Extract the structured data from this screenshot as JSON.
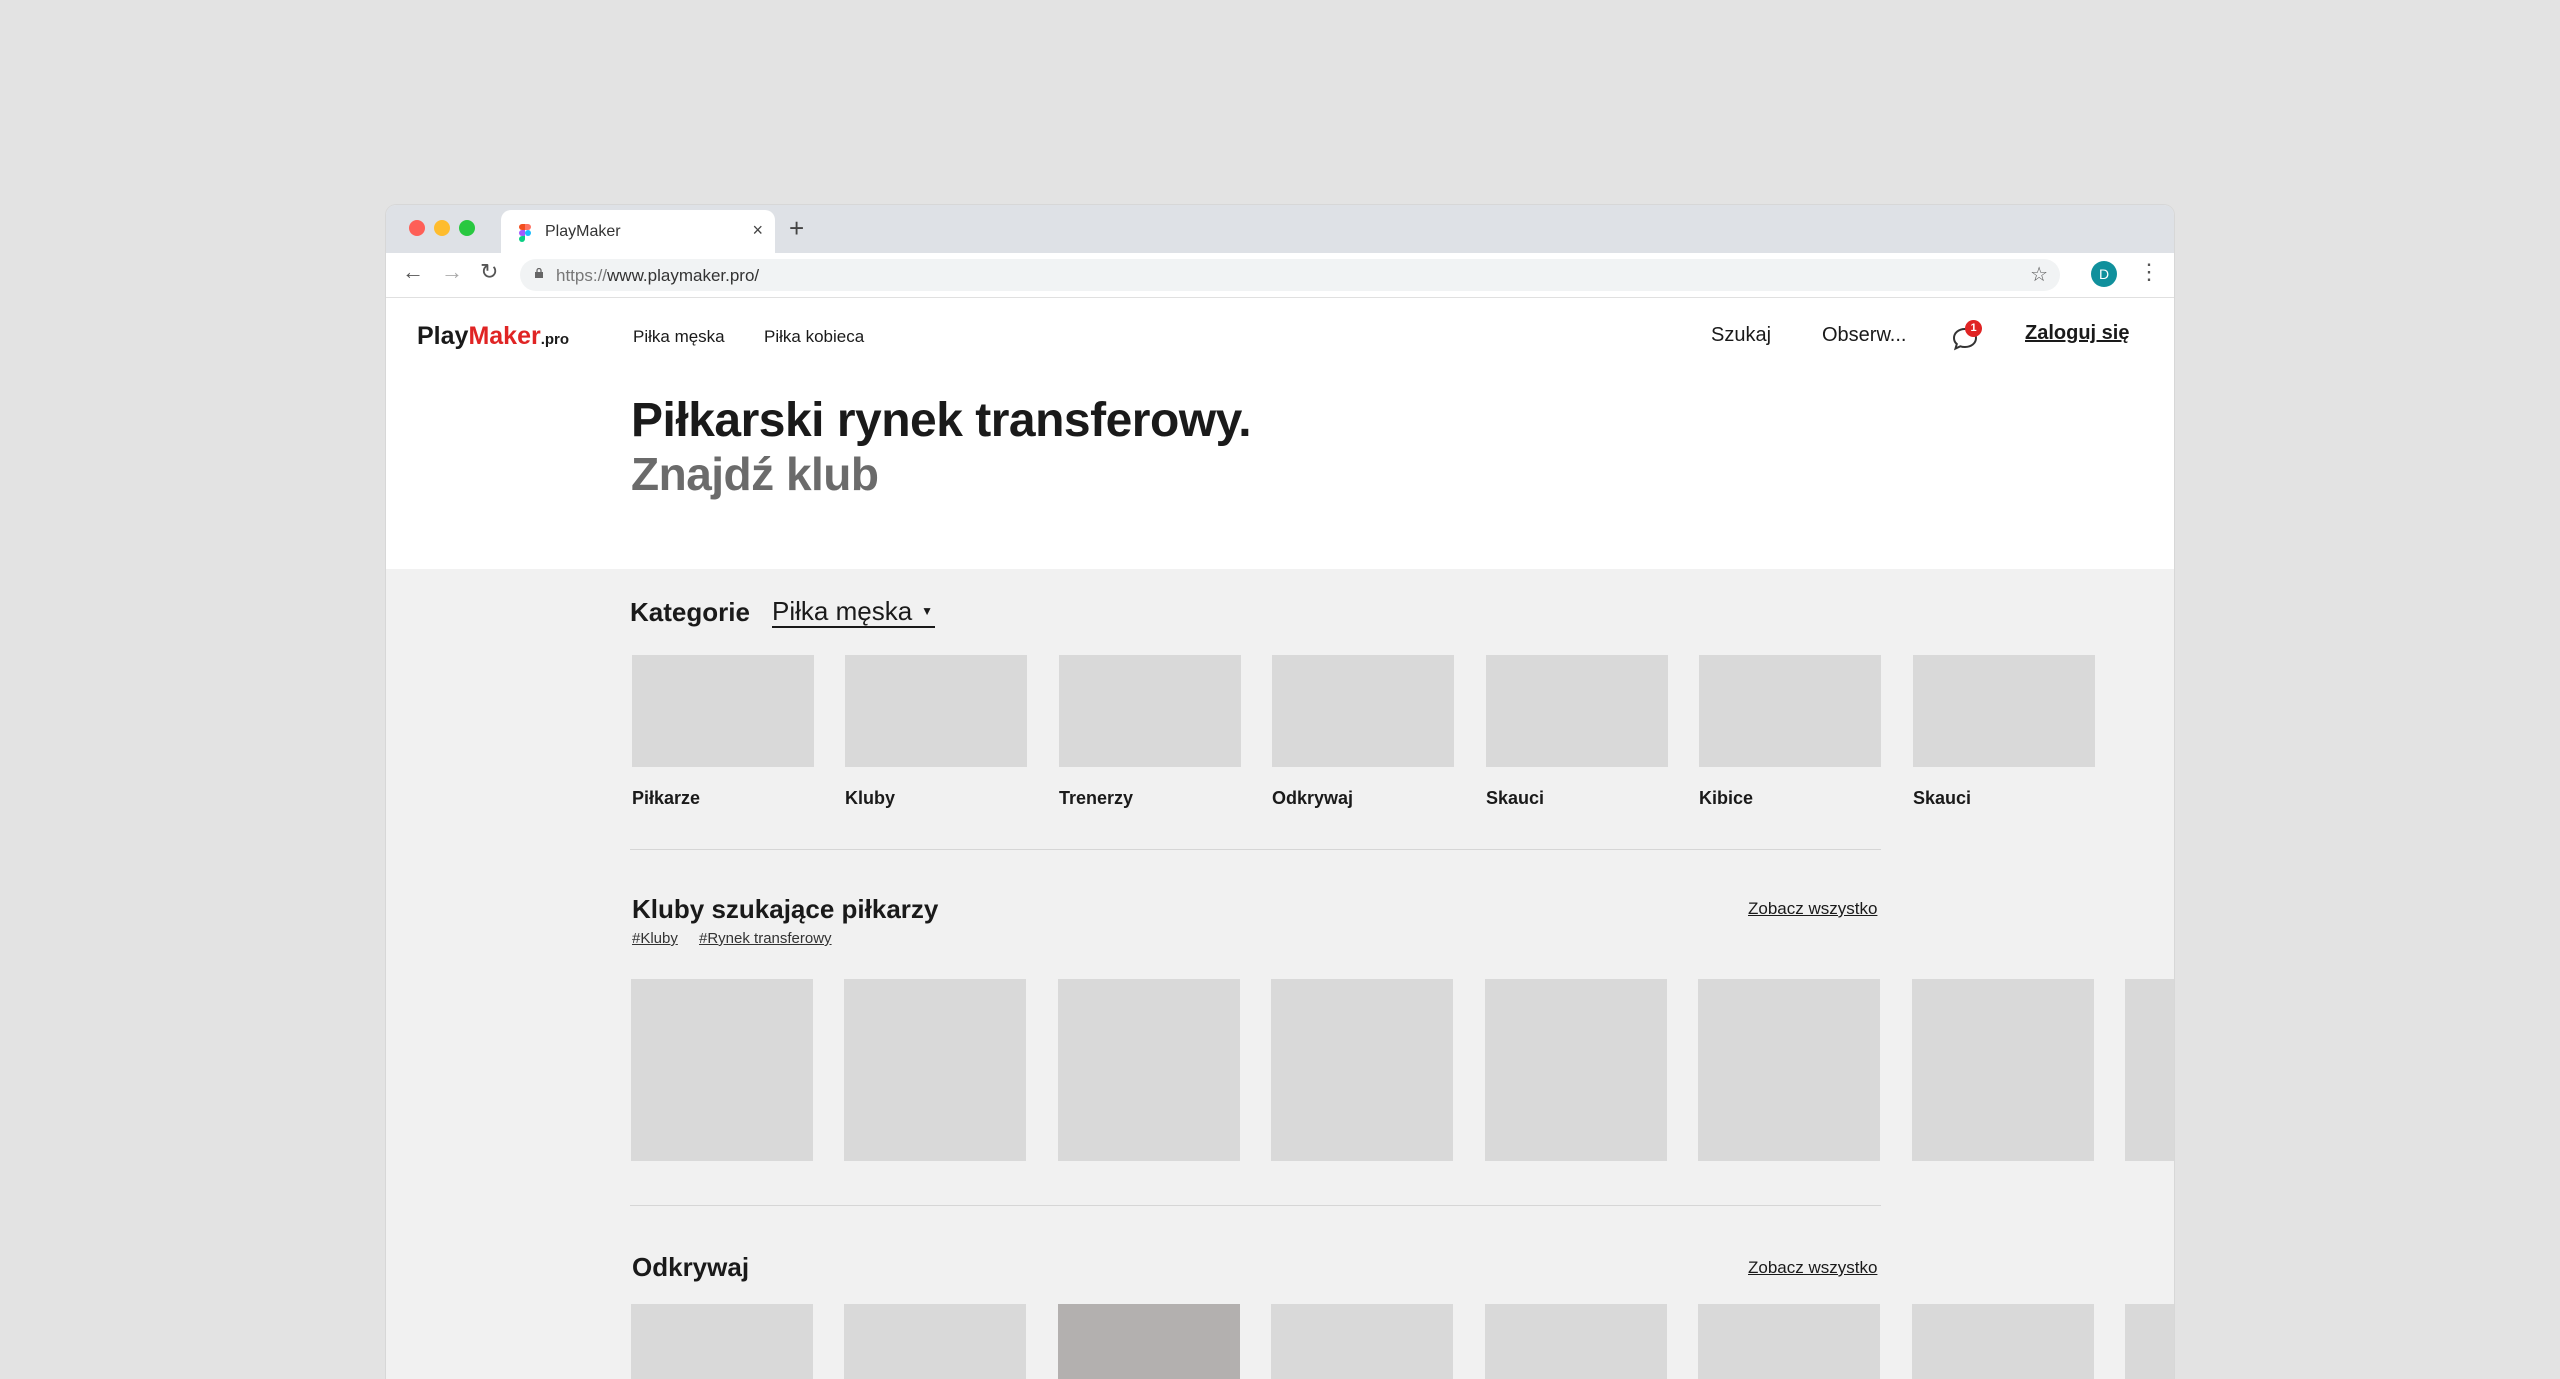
{
  "browser": {
    "tab_title": "PlayMaker",
    "url_protocol": "https://",
    "url_rest": "www.playmaker.pro/",
    "avatar_letter": "D"
  },
  "header": {
    "logo_play": "Play",
    "logo_maker": "Maker",
    "logo_tld": ".pro",
    "nav": [
      "Piłka męska",
      "Piłka kobieca"
    ],
    "search_label": "Szukaj",
    "watch_label": "Obserw...",
    "notification_count": "1",
    "login_label": "Zaloguj się"
  },
  "hero": {
    "title": "Piłkarski rynek transferowy.",
    "subtitle": "Znajdź klub"
  },
  "categories": {
    "label": "Kategorie",
    "selected": "Piłka męska",
    "items": [
      "Piłkarze",
      "Kluby",
      "Trenerzy",
      "Odkrywaj",
      "Skauci",
      "Kibice",
      "Skauci"
    ]
  },
  "clubs_section": {
    "title": "Kluby szukające piłkarzy",
    "see_all": "Zobacz wszystko",
    "tags": [
      "#Kluby",
      "#Rynek transferowy"
    ]
  },
  "discover_section": {
    "title": "Odkrywaj",
    "see_all": "Zobacz wszystko"
  },
  "colors": {
    "brand_red": "#e02424",
    "avatar": "#10909c"
  }
}
